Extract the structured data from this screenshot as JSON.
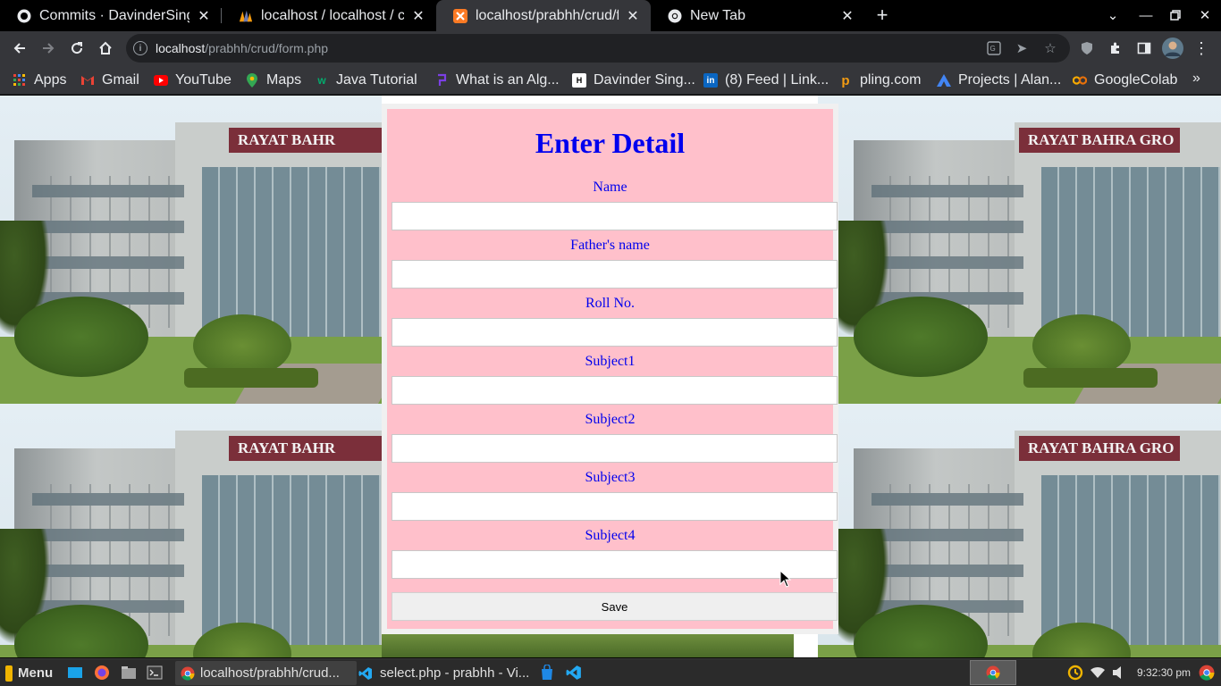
{
  "browser": {
    "tabs": [
      {
        "title": "Commits · DavinderSingh",
        "favicon": "github-icon",
        "active": false
      },
      {
        "title": "localhost / localhost / co",
        "favicon": "phpmyadmin-icon",
        "active": false
      },
      {
        "title": "localhost/prabhh/crud/f",
        "favicon": "xampp-icon",
        "active": true
      },
      {
        "title": "New Tab",
        "favicon": "chrome-icon",
        "active": false
      }
    ],
    "new_tab_label": "+",
    "address": {
      "host": "localhost",
      "path": "/prabhh/crud/form.php"
    },
    "bookmarks": [
      {
        "label": "Apps",
        "icon": "apps-grid-icon",
        "color": "#ea4335"
      },
      {
        "label": "Gmail",
        "icon": "gmail-icon",
        "color": "#ea4335"
      },
      {
        "label": "YouTube",
        "icon": "youtube-icon",
        "color": "#ff0000"
      },
      {
        "label": "Maps",
        "icon": "maps-icon",
        "color": "#34a853"
      },
      {
        "label": "Java Tutorial",
        "icon": "w3schools-icon",
        "color": "#04aa6d"
      },
      {
        "label": "What is an Alg...",
        "icon": "hashnode-icon",
        "color": "#7b3fe4"
      },
      {
        "label": "Davinder Sing...",
        "icon": "hackerrank-icon",
        "color": "#ffffff"
      },
      {
        "label": "(8) Feed | Link...",
        "icon": "linkedin-icon",
        "color": "#0a66c2"
      },
      {
        "label": "pling.com",
        "icon": "pling-icon",
        "color": "#f39c12"
      },
      {
        "label": "Projects | Alan...",
        "icon": "alan-icon",
        "color": "#4285f4"
      },
      {
        "label": "GoogleColab",
        "icon": "colab-icon",
        "color": "#f9ab00"
      }
    ]
  },
  "form": {
    "title": "Enter Detail",
    "fields": [
      {
        "label": "Name",
        "value": ""
      },
      {
        "label": "Father's name",
        "value": ""
      },
      {
        "label": "Roll No.",
        "value": ""
      },
      {
        "label": "Subject1",
        "value": ""
      },
      {
        "label": "Subject2",
        "value": ""
      },
      {
        "label": "Subject3",
        "value": ""
      },
      {
        "label": "Subject4",
        "value": ""
      }
    ],
    "save_label": "Save",
    "panel_color": "#ffc0cb",
    "text_color": "#0000ee"
  },
  "background": {
    "banner_text": [
      "RAYAT BAHR",
      "RAYAT BAHRA GRO",
      "RAYAT BAHR",
      "RAYAT BAHRA GRO"
    ]
  },
  "taskbar": {
    "menu_label": "Menu",
    "windows": [
      {
        "title": "localhost/prabhh/crud...",
        "icon": "chrome-icon",
        "active": true
      },
      {
        "title": "select.php - prabhh - Vi...",
        "icon": "vscode-icon",
        "active": false
      }
    ],
    "clock": "9:32:30 pm"
  }
}
